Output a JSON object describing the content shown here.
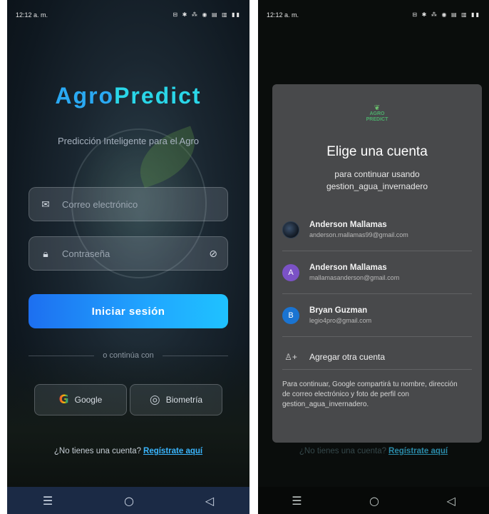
{
  "screen1": {
    "status": {
      "time": "12:12 a. m.",
      "icons": "⊟ ✱ ⁂ ◉ ▤ ▥ ▮▮"
    },
    "app_title_part1": "Agro",
    "app_title_part2": "Predict",
    "subtitle": "Predicción Inteligente para el Agro",
    "email_placeholder": "Correo electrónico",
    "password_placeholder": "Contraseña",
    "login_button": "Iniciar sesión",
    "divider_text": "o continúa con",
    "google_button": "Google",
    "biometric_button": "Biometría",
    "signup_prompt": "¿No tienes una cuenta?",
    "signup_link": "Regístrate aquí",
    "nav": {
      "menu": "☰",
      "home": "○",
      "back": "◁"
    }
  },
  "screen2": {
    "status": {
      "time": "12:12 a. m.",
      "icons": "⊟ ✱ ⁂ ◉ ▤ ▥ ▮▮"
    },
    "logo_text_1": "AGRO",
    "logo_text_2": "PREDICT",
    "dialog_title": "Elige una cuenta",
    "dialog_subtitle_1": "para continuar usando",
    "dialog_subtitle_2": "gestion_agua_invernadero",
    "accounts": [
      {
        "name": "Anderson Mallamas",
        "email": "anderson.mallamas99@gmail.com",
        "initial": ""
      },
      {
        "name": "Anderson Mallamas",
        "email": "mallamasanderson@gmail.com",
        "initial": "A"
      },
      {
        "name": "Bryan Guzman",
        "email": "legio4pro@gmail.com",
        "initial": "B"
      }
    ],
    "add_account": "Agregar otra cuenta",
    "disclaimer": "Para continuar, Google compartirá tu nombre, dirección de correo electrónico y foto de perfil con gestion_agua_invernadero.",
    "signup_prompt": "¿No tienes una cuenta?",
    "signup_link": "Regístrate aquí",
    "nav": {
      "menu": "☰",
      "home": "○",
      "back": "◁"
    }
  }
}
